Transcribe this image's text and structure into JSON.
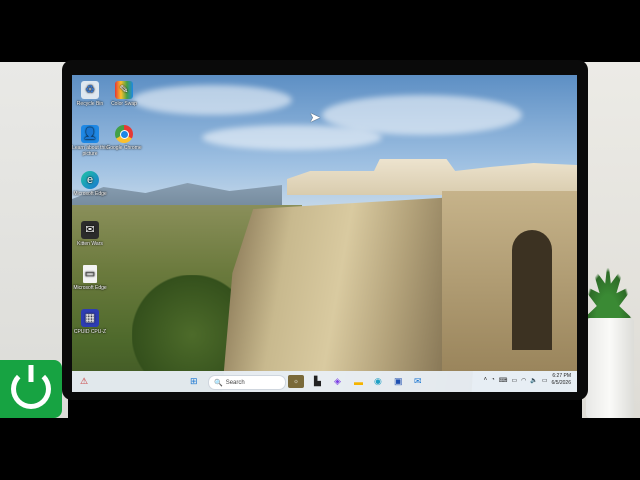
{
  "desktop": {
    "icons": [
      {
        "label": "Recycle Bin",
        "icon": "recycle-bin-icon"
      },
      {
        "label": "Color Swap",
        "icon": "color-swap-icon"
      },
      {
        "label": "Learn about this picture",
        "icon": "learn-about-picture-icon"
      },
      {
        "label": "Google Chrome",
        "icon": "chrome-icon"
      },
      {
        "label": "Microsoft Edge",
        "icon": "edge-icon"
      },
      {
        "label": "Kitten Wars",
        "icon": "kitten-wars-icon"
      },
      {
        "label": "Microsoft Edge",
        "icon": "file-shortcut-icon"
      },
      {
        "label": "CPUID CPU-Z",
        "icon": "cpu-z-icon"
      }
    ]
  },
  "taskbar": {
    "search_placeholder": "Search",
    "time": "6:27 PM",
    "date": "6/5/2026",
    "pinned": [
      "start-icon",
      "search-icon",
      "widgets-icon",
      "task-view-icon",
      "copilot-icon",
      "file-explorer-icon",
      "edge-icon",
      "store-icon",
      "mail-icon"
    ]
  },
  "colors": {
    "taskbar_bg": "#e8eef5",
    "accent": "#1976d2",
    "power_logo": "#17a342"
  }
}
